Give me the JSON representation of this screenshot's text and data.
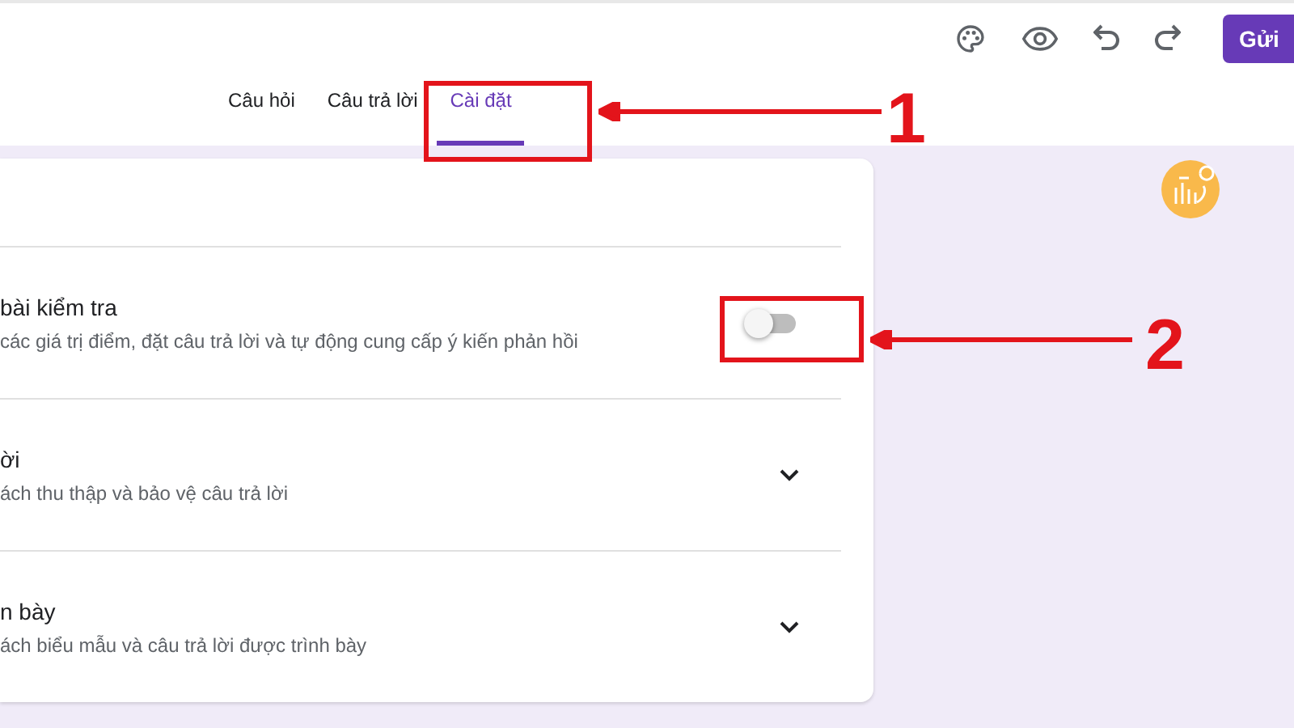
{
  "toolbar": {
    "send_button": "Gửi"
  },
  "tabs": [
    {
      "label": "Câu hỏi",
      "selected": false
    },
    {
      "label": "Câu trả lời",
      "selected": false
    },
    {
      "label": "Cài đặt",
      "selected": true
    }
  ],
  "settings": [
    {
      "kind": "toggle",
      "title": "bài kiểm tra",
      "description": "các giá trị điểm, đặt câu trả lời và tự động cung cấp ý kiến phản hồi",
      "checked": false
    },
    {
      "kind": "expand",
      "title": "ời",
      "description": "ách thu thập và bảo vệ câu trả lời",
      "expanded": false
    },
    {
      "kind": "expand",
      "title": "n bày",
      "description": "ách biểu mẫu và câu trả lời được trình bày",
      "expanded": false
    }
  ],
  "annotations": [
    {
      "label": "1"
    },
    {
      "label": "2"
    }
  ]
}
